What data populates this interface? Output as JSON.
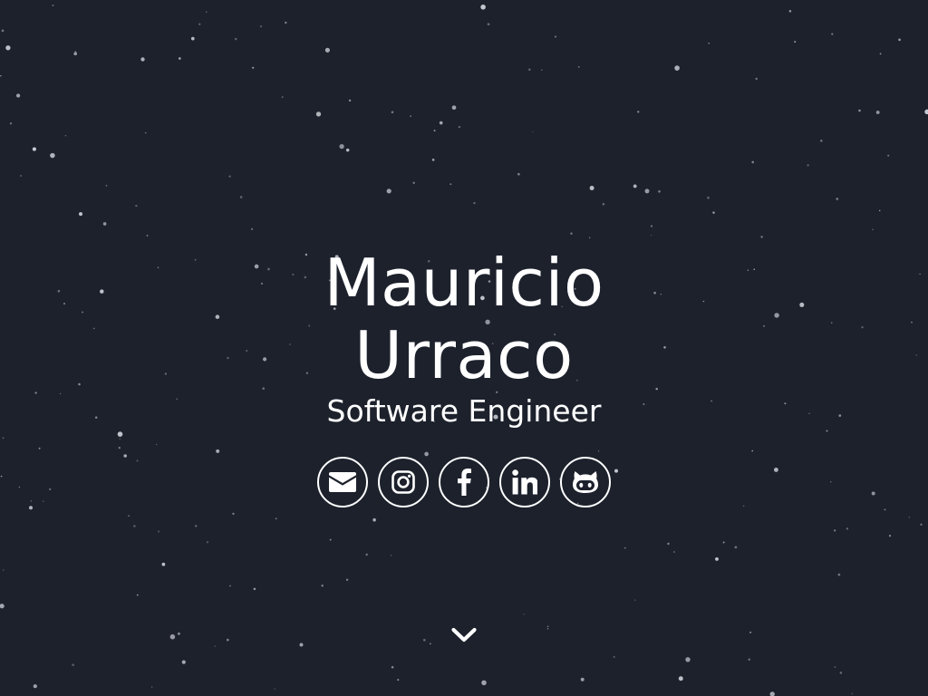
{
  "hero": {
    "name_line1": "Mauricio",
    "name_line2": "Urraco",
    "title": "Software Engineer"
  },
  "social_links": [
    {
      "icon": "envelope-icon"
    },
    {
      "icon": "instagram-icon"
    },
    {
      "icon": "facebook-icon"
    },
    {
      "icon": "linkedin-icon"
    },
    {
      "icon": "github-icon"
    }
  ],
  "scroll_indicator": {
    "icon": "chevron-down-icon"
  },
  "colors": {
    "background": "#1c212c",
    "foreground": "#ffffff",
    "stars": "#c9ccd3"
  }
}
